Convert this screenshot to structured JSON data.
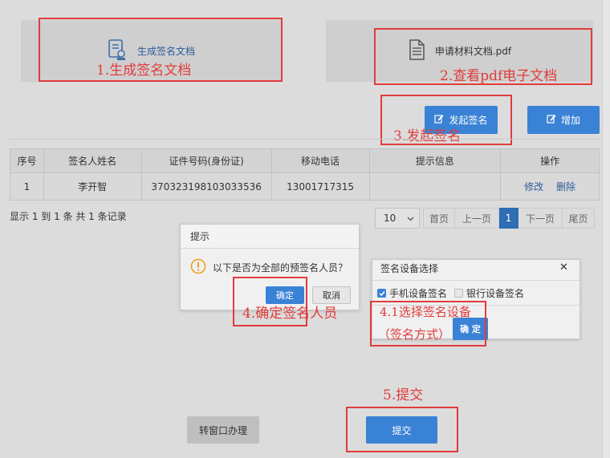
{
  "cards": {
    "generate_label": "生成签名文档",
    "pdf_label": "申请材料文档.pdf"
  },
  "annotations": {
    "step1": "1.生成签名文档",
    "step2": "2.查看pdf电子文档",
    "step3": "3.发起签名",
    "step4": "4.确定签名人员",
    "step41_line1": "4.1选择签名设备",
    "step41_line2": "（签名方式）",
    "step5": "5.提交"
  },
  "toolbar": {
    "start_sign_label": "发起签名",
    "add_label": "增加"
  },
  "table": {
    "headers": [
      "序号",
      "签名人姓名",
      "证件号码(身份证)",
      "移动电话",
      "提示信息",
      "操作"
    ],
    "rows": [
      {
        "index": "1",
        "name": "李开智",
        "id_number": "370323198103033536",
        "phone": "13001717315",
        "hint": "",
        "edit": "修改",
        "delete": "删除"
      }
    ]
  },
  "pagination": {
    "summary": "显示 1 到 1 条 共 1 条记录",
    "page_size": "10",
    "first": "首页",
    "prev": "上一页",
    "current": "1",
    "next": "下一页",
    "last": "尾页"
  },
  "confirm_dialog": {
    "title": "提示",
    "message": "以下是否为全部的预签名人员？",
    "ok_label": "确定",
    "cancel_label": "取消"
  },
  "device_dialog": {
    "title": "签名设备选择",
    "close": "✕",
    "option1": "手机设备签名",
    "option2": "银行设备签名",
    "ok_label": "确 定"
  },
  "footer": {
    "window_label": "转窗口办理",
    "submit_label": "提交"
  },
  "colors": {
    "accent": "#3a82d6",
    "annotation": "#e23b3b"
  }
}
